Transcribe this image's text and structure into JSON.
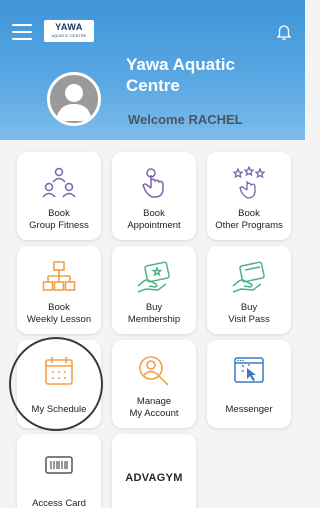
{
  "header": {
    "logo_text": "YAWA",
    "logo_subtext": "AQUATIC CENTRE",
    "title_line1": "Yawa Aquatic",
    "title_line2": "Centre",
    "welcome": "Welcome RACHEL"
  },
  "icons": {
    "menu": "hamburger-menu-icon",
    "bell": "bell-icon",
    "avatar": "user-avatar-icon"
  },
  "colors": {
    "header": "#4a9ede",
    "icon_green": "#4db287",
    "icon_orange": "#f0a04a",
    "icon_purple": "#7c63b0",
    "icon_blue": "#3b78c4",
    "highlight_ring": "#3a3a3a"
  },
  "tiles": [
    {
      "line1": "Book",
      "line2": "Group Fitness"
    },
    {
      "line1": "Book",
      "line2": "Appointment"
    },
    {
      "line1": "Book",
      "line2": "Other Programs"
    },
    {
      "line1": "Book",
      "line2": "Weekly Lesson"
    },
    {
      "line1": "Buy",
      "line2": "Membership"
    },
    {
      "line1": "Buy",
      "line2": "Visit Pass"
    },
    {
      "line1": "My Schedule"
    },
    {
      "line1": "Manage",
      "line2": "My Account"
    },
    {
      "line1": "Messenger"
    },
    {
      "line1": "Access Card"
    },
    {
      "logo_text": "ADVAGYM"
    }
  ]
}
